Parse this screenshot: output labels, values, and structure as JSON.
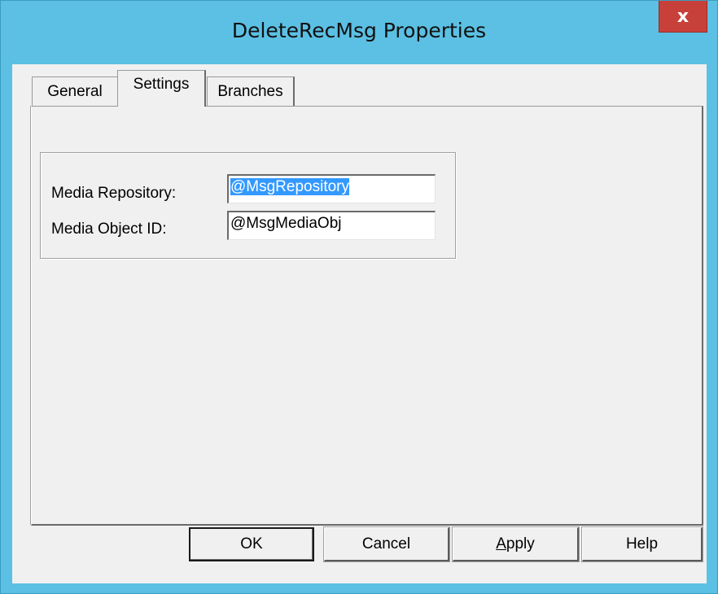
{
  "window": {
    "title": "DeleteRecMsg Properties",
    "close_glyph": "x"
  },
  "tabs": [
    {
      "label": "General"
    },
    {
      "label": "Settings",
      "selected": true
    },
    {
      "label": "Branches"
    }
  ],
  "settings": {
    "media_repository_label": "Media Repository:",
    "media_repository_value": "@MsgRepository",
    "media_object_id_label": "Media Object ID:",
    "media_object_id_value": "@MsgMediaObj"
  },
  "buttons": {
    "ok": "OK",
    "cancel": "Cancel",
    "apply_prefix": "A",
    "apply_rest": "pply",
    "help": "Help"
  },
  "colors": {
    "titlebar": "#5bc0e3",
    "close": "#c7413a",
    "selection": "#3399ff"
  }
}
